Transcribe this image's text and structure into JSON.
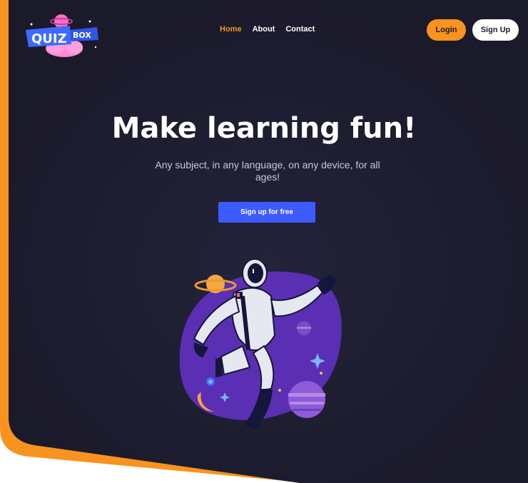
{
  "brand": {
    "logo_word1": "QUIZ",
    "logo_word2": "BOX"
  },
  "nav": {
    "items": [
      {
        "label": "Home",
        "active": true
      },
      {
        "label": "About",
        "active": false
      },
      {
        "label": "Contact",
        "active": false
      }
    ]
  },
  "auth": {
    "login_label": "Login",
    "signup_label": "Sign Up"
  },
  "hero": {
    "title": "Make learning fun!",
    "subtitle": "Any subject, in any language, on any device, for all ages!",
    "cta_label": "Sign up for free"
  },
  "illustration": {
    "icon": "astronaut-illustration"
  },
  "colors": {
    "background": "#1b1a2b",
    "accent_orange": "#f7931e",
    "cta_blue": "#3d5afe",
    "blob_purple": "#5a2fb3",
    "logo_pink": "#ff6ec7",
    "logo_blue": "#3d6bff"
  }
}
